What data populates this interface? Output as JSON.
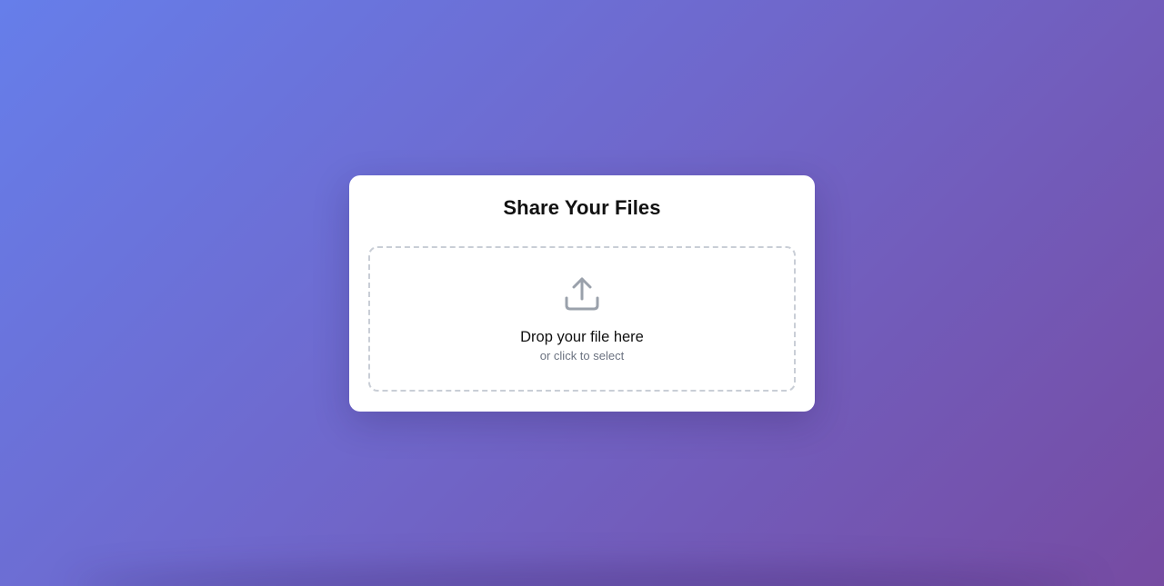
{
  "card": {
    "title": "Share Your Files"
  },
  "dropzone": {
    "primary_text": "Drop your file here",
    "secondary_text": "or click to select",
    "icon": "upload-icon"
  },
  "colors": {
    "background_start": "#667eea",
    "background_end": "#764ba2",
    "card": "#ffffff",
    "dashed_border": "#c9ced6",
    "icon": "#9aa1ab",
    "secondary_text": "#6b7280"
  }
}
